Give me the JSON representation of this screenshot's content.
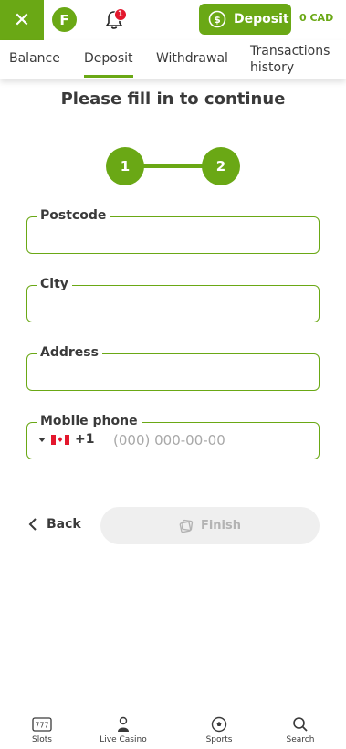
{
  "header": {
    "close_icon": "close-icon",
    "avatar_letter": "F",
    "notification_count": "1",
    "deposit_label": "Deposit",
    "balance": "0 CAD",
    "accent_color": "#6aa815"
  },
  "tabs": [
    {
      "label": "Balance"
    },
    {
      "label": "Deposit"
    },
    {
      "label": "Withdrawal"
    },
    {
      "label": "Transactions history"
    }
  ],
  "form": {
    "heading": "Please fill in to continue",
    "steps": [
      "1",
      "2"
    ],
    "fields": {
      "postcode": {
        "label": "Postcode",
        "value": ""
      },
      "city": {
        "label": "City",
        "value": ""
      },
      "address": {
        "label": "Address",
        "value": ""
      },
      "phone": {
        "label": "Mobile phone",
        "dial_code": "+1",
        "placeholder": "(000) 000-00-00"
      }
    },
    "back_label": "Back",
    "finish_label": "Finish"
  },
  "bottom_nav": [
    {
      "label": "Slots",
      "icon": "slot-machine-icon"
    },
    {
      "label": "Live Casino",
      "icon": "dealer-icon"
    },
    {
      "label": "Sports",
      "icon": "soccer-ball-icon"
    },
    {
      "label": "Search",
      "icon": "search-icon"
    }
  ]
}
